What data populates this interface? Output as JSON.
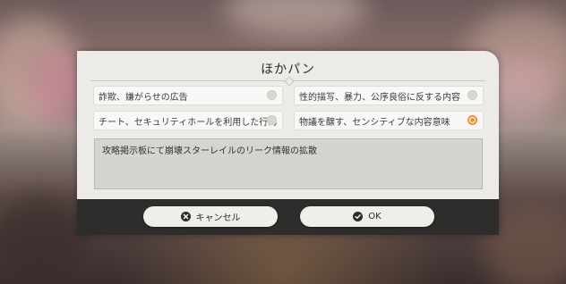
{
  "dialog": {
    "title": "ほかパン",
    "options": [
      {
        "label": "詐欺、嫌がらせの広告",
        "selected": false
      },
      {
        "label": "性的描写、暴力、公序良俗に反する内容",
        "selected": false
      },
      {
        "label": "チート、セキュリティホールを利用した行為",
        "selected": false
      },
      {
        "label": "物議を醸す、センシティブな内容意味",
        "selected": true
      }
    ],
    "comment": "攻略掲示板にて崩壊スターレイルのリーク情報の拡散",
    "cancel_label": "キャンセル",
    "ok_label": "OK",
    "cancel_icon": "x-circle-icon",
    "ok_icon": "check-circle-icon",
    "accent_color": "#e8933a"
  }
}
